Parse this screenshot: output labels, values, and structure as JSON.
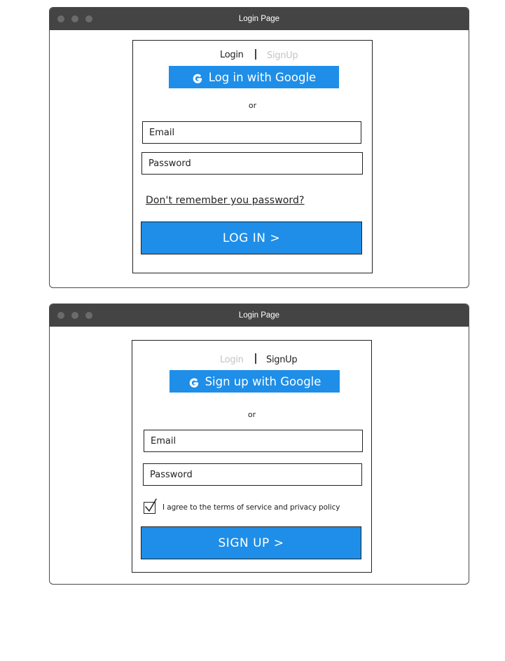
{
  "login_window": {
    "title": "Login Page",
    "tabs": {
      "login": "Login",
      "signup": "SignUp",
      "active": "login"
    },
    "google_button": "Log in with Google",
    "or_text": "or",
    "email_placeholder": "Email",
    "password_placeholder": "Password",
    "forgot_link": "Don't remember you password?",
    "submit_button": "LOG IN >"
  },
  "signup_window": {
    "title": "Login Page",
    "tabs": {
      "login": "Login",
      "signup": "SignUp",
      "active": "signup"
    },
    "google_button": "Sign up with Google",
    "or_text": "or",
    "email_placeholder": "Email",
    "password_placeholder": "Password",
    "terms_checkbox": {
      "checked": true,
      "label": "I agree to the terms of service and privacy policy"
    },
    "submit_button": "SIGN UP >"
  },
  "colors": {
    "titlebar": "#444444",
    "accent": "#1e8ee8",
    "inactive_tab": "#c4c4c4"
  },
  "icons": {
    "google": "google-g-icon",
    "window_controls": "window-control-dot"
  }
}
